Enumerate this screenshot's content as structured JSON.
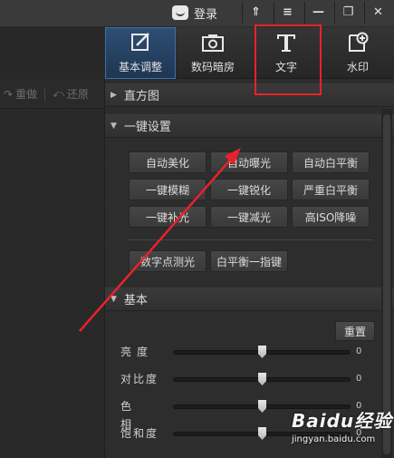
{
  "titlebar": {
    "login_label": "登录",
    "buttons": [
      "⇑",
      "≡",
      "—",
      "❐",
      "✕"
    ]
  },
  "toolbar": {
    "tabs": [
      {
        "label": "基本调整",
        "icon": "adjust-edit-icon",
        "active": true
      },
      {
        "label": "数码暗房",
        "icon": "camera-icon",
        "active": false
      },
      {
        "label": "文字",
        "icon": "text-icon",
        "active": false
      },
      {
        "label": "水印",
        "icon": "watermark-add-icon",
        "active": false
      }
    ]
  },
  "left_panel": {
    "redo_label": "重做",
    "restore_label": "还原"
  },
  "sections": {
    "histogram": "直方图",
    "one_click": "一键设置",
    "basic": "基本"
  },
  "one_click_buttons": [
    [
      "自动美化",
      "自动曝光",
      "自动白平衡"
    ],
    [
      "一键模糊",
      "一键锐化",
      "严重白平衡"
    ],
    [
      "一键补光",
      "一键减光",
      "高ISO降噪"
    ]
  ],
  "extra_buttons": [
    "数字点测光",
    "白平衡一指键"
  ],
  "basic": {
    "reset_label": "重置",
    "sliders": [
      {
        "label": "亮度",
        "value": "0"
      },
      {
        "label": "对比度",
        "value": "0"
      },
      {
        "label": "色相",
        "value": "0"
      },
      {
        "label": "饱和度",
        "value": "0"
      }
    ]
  },
  "watermark": {
    "brand": "Baidu经验",
    "site": "jingyan.baidu.com"
  },
  "colors": {
    "accent_active": "#2e4e74",
    "annotation_red": "#e8222a"
  }
}
